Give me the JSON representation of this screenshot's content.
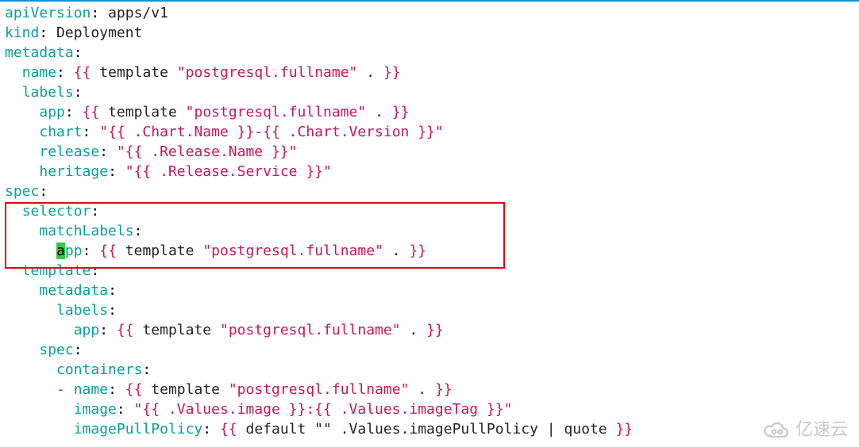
{
  "line1": {
    "key": "apiVersion",
    "val": "apps/v1"
  },
  "line2": {
    "key": "kind",
    "val": "Deployment"
  },
  "line3": {
    "key": "metadata"
  },
  "line4": {
    "key": "name",
    "tplkw": "template",
    "arg": "\"postgresql.fullname\"",
    "dot": "."
  },
  "line5": {
    "key": "labels"
  },
  "line6": {
    "key": "app",
    "tplkw": "template",
    "arg": "\"postgresql.fullname\"",
    "dot": "."
  },
  "line7": {
    "key": "chart",
    "val": "\"{{ .Chart.Name }}-{{ .Chart.Version }}\""
  },
  "line8": {
    "key": "release",
    "val": "\"{{ .Release.Name }}\""
  },
  "line9": {
    "key": "heritage",
    "val": "\"{{ .Release.Service }}\""
  },
  "line10": {
    "key": "spec"
  },
  "line11": {
    "key": "selector"
  },
  "line12": {
    "key": "matchLabels"
  },
  "line13": {
    "cursor": "a",
    "rest": "pp",
    "tplkw": "template",
    "arg": "\"postgresql.fullname\"",
    "dot": "."
  },
  "line14": {
    "key": "template"
  },
  "line15": {
    "key": "metadata"
  },
  "line16": {
    "key": "labels"
  },
  "line17": {
    "key": "app",
    "tplkw": "template",
    "arg": "\"postgresql.fullname\"",
    "dot": "."
  },
  "line18": {
    "key": "spec"
  },
  "line19": {
    "key": "containers"
  },
  "line20": {
    "dash": "-",
    "key": "name",
    "tplkw": "template",
    "arg": "\"postgresql.fullname\"",
    "dot": "."
  },
  "line21": {
    "key": "image",
    "val": "\"{{ .Values.image }}:{{ .Values.imageTag }}\""
  },
  "line22": {
    "key": "imagePullPolicy",
    "open": "{{",
    "body": " default \"\" .Values.imagePullPolicy | quote ",
    "close": "}}"
  },
  "watermark": "亿速云"
}
